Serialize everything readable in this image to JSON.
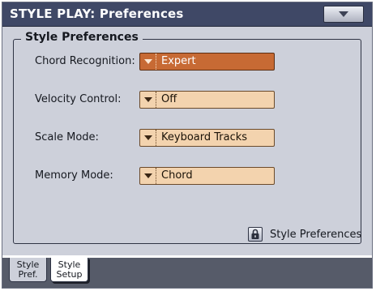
{
  "title_bar": {
    "title": "STYLE PLAY: Preferences",
    "menu_icon": "chevron-down-icon"
  },
  "group": {
    "title": "Style Preferences"
  },
  "rows": [
    {
      "label": "Chord Recognition:",
      "value": "Expert",
      "selected": true
    },
    {
      "label": "Velocity Control:",
      "value": "Off",
      "selected": false
    },
    {
      "label": "Scale Mode:",
      "value": "Keyboard Tracks",
      "selected": false
    },
    {
      "label": "Memory Mode:",
      "value": "Chord",
      "selected": false
    }
  ],
  "lock": {
    "icon": "lock-icon",
    "label": "Style Preferences"
  },
  "tabs": [
    {
      "line1": "Style",
      "line2": "Pref.",
      "active": true
    },
    {
      "line1": "Style",
      "line2": "Setup",
      "active": false
    }
  ],
  "colors": {
    "title_bar": "#3f4866",
    "panel": "#cdd0da",
    "dropdown": "#f3d3ae",
    "dropdown_selected": "#c76a34",
    "tab_strip": "#565b69"
  }
}
